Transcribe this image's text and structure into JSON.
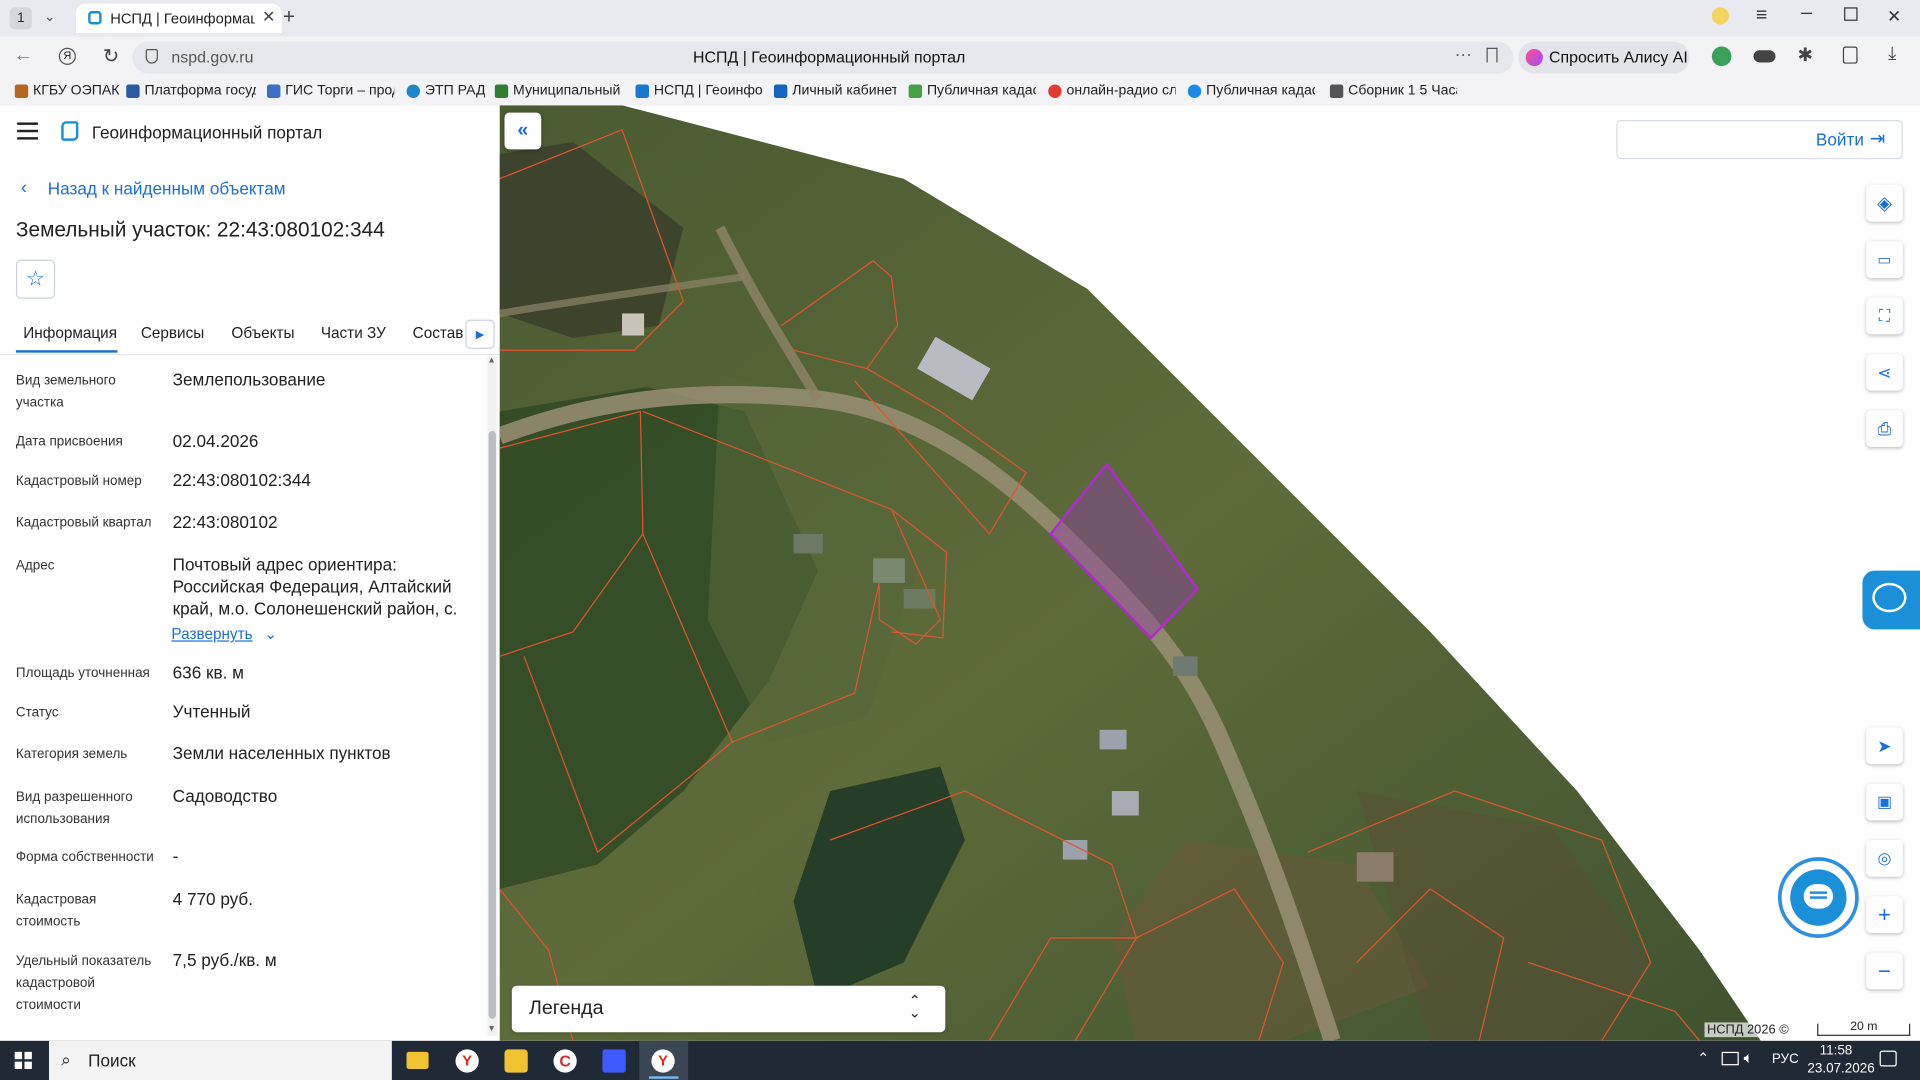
{
  "browser": {
    "tab_count": "1",
    "tab_title": "НСПД | Геоинформаци",
    "url": "nspd.gov.ru",
    "page_title": "НСПД | Геоинформационный портал",
    "alice_label": "Спросить Алису AI",
    "bookmarks": [
      {
        "label": "КГБУ ОЭПАК",
        "color": "#b5651d"
      },
      {
        "label": "Платформа госуд",
        "color": "#2c5aa0"
      },
      {
        "label": "ГИС Торги – прод",
        "color": "#3b6fc4"
      },
      {
        "label": "ЭТП РАД",
        "color": "#1a88c9"
      },
      {
        "label": "Муниципальный",
        "color": "#2e7d32"
      },
      {
        "label": "НСПД | Геоинфор",
        "color": "#1976d2"
      },
      {
        "label": "Личный кабинет",
        "color": "#1565c0"
      },
      {
        "label": "Публичная кадас",
        "color": "#43a047"
      },
      {
        "label": "онлайн-радио слу",
        "color": "#e53935"
      },
      {
        "label": "Публичная кадас",
        "color": "#1e88e5"
      },
      {
        "label": "Сборник 1 5 Часа",
        "color": "#555555"
      }
    ]
  },
  "portal": {
    "app_title": "Геоинформационный портал",
    "back_link": "Назад к найденным объектам",
    "object_title": "Земельный участок: 22:43:080102:344",
    "tabs": [
      "Информация",
      "Сервисы",
      "Объекты",
      "Части ЗУ",
      "Состав"
    ],
    "fields": [
      {
        "label": "Вид земельного участка",
        "value": "Землепользование"
      },
      {
        "label": "Дата присвоения",
        "value": "02.04.2026"
      },
      {
        "label": "Кадастровый номер",
        "value": "22:43:080102:344"
      },
      {
        "label": "Кадастровый квартал",
        "value": "22:43:080102"
      },
      {
        "label": "Адрес",
        "value": "Почтовый адрес ориентира: Российская Федерация, Алтайский край, м.о. Солонешенский район, с.",
        "expand": "Развернуть"
      },
      {
        "label": "Площадь уточненная",
        "value": "636 кв. м"
      },
      {
        "label": "Статус",
        "value": "Учтенный"
      },
      {
        "label": "Категория земель",
        "value": "Земли населенных пунктов"
      },
      {
        "label": "Вид разрешенного использования",
        "value": "Садоводство"
      },
      {
        "label": "Форма собственности",
        "value": "-"
      },
      {
        "label": "Кадастровая стоимость",
        "value": "4 770 руб."
      },
      {
        "label": "Удельный показатель кадастровой стоимости",
        "value": "7,5 руб./кв. м"
      }
    ]
  },
  "map": {
    "login_label": "Войти",
    "legend_label": "Легенда",
    "copyright": "НСПД 2026 ©",
    "scale": "20 m",
    "accent_color": "#1b6fd8",
    "selected_parcel_color": "#b02ad1"
  },
  "taskbar": {
    "search_placeholder": "Поиск",
    "lang": "РУС",
    "time": "11:58",
    "date": "23.07.2026"
  }
}
